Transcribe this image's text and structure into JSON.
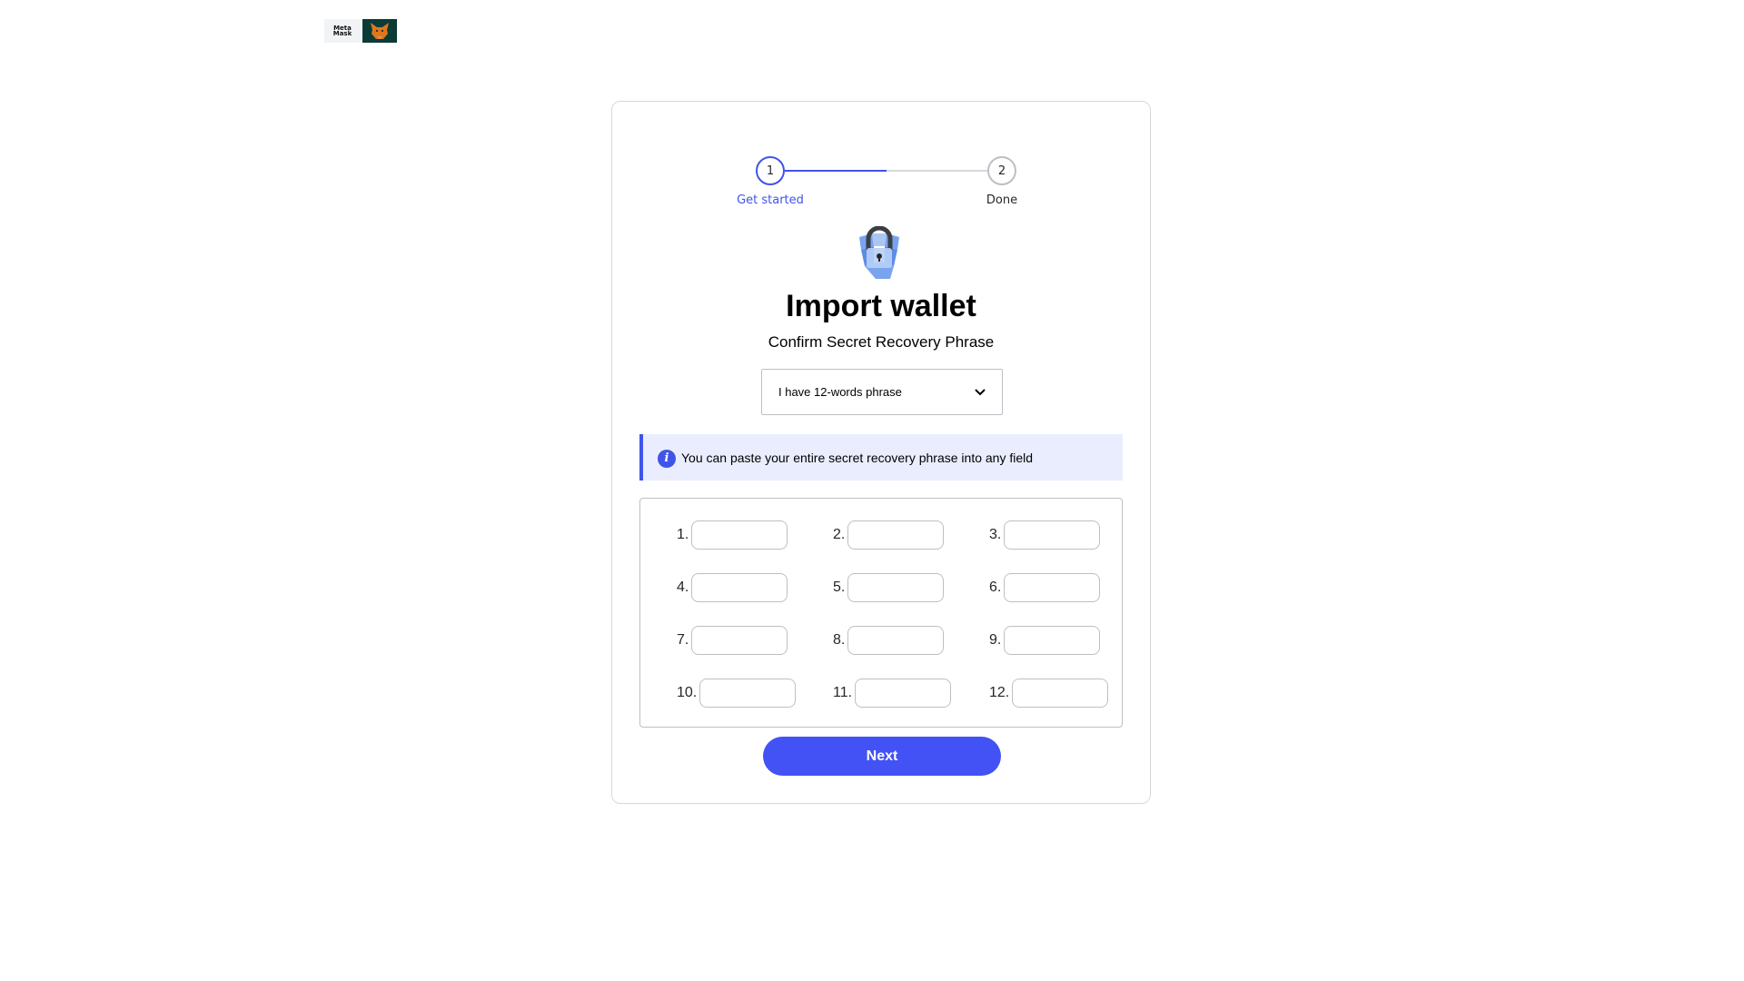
{
  "header": {
    "logo_word_line1": "Meta",
    "logo_word_line2": "Mask",
    "logo_icon": "fox-icon"
  },
  "stepper": {
    "steps": [
      {
        "number": "1",
        "label": "Get started",
        "state": "active"
      },
      {
        "number": "2",
        "label": "Done",
        "state": "inactive"
      }
    ],
    "progress": 0.5
  },
  "main": {
    "icon": "lock-icon",
    "title": "Import wallet",
    "subtitle": "Confirm Secret Recovery Phrase",
    "phrase_select": {
      "selected": "I have 12-words phrase"
    },
    "info_banner": {
      "icon": "info-icon",
      "text": "You can paste your entire secret recovery phrase into any field"
    },
    "words": [
      {
        "label": "1.",
        "value": ""
      },
      {
        "label": "2.",
        "value": ""
      },
      {
        "label": "3.",
        "value": ""
      },
      {
        "label": "4.",
        "value": ""
      },
      {
        "label": "5.",
        "value": ""
      },
      {
        "label": "6.",
        "value": ""
      },
      {
        "label": "7.",
        "value": ""
      },
      {
        "label": "8.",
        "value": ""
      },
      {
        "label": "9.",
        "value": ""
      },
      {
        "label": "10.",
        "value": ""
      },
      {
        "label": "11.",
        "value": ""
      },
      {
        "label": "12.",
        "value": ""
      }
    ],
    "next_label": "Next"
  },
  "colors": {
    "accent": "#4054e8",
    "button": "#4352f5",
    "banner_bg": "#eaedfd",
    "border": "#bbc0c5"
  }
}
